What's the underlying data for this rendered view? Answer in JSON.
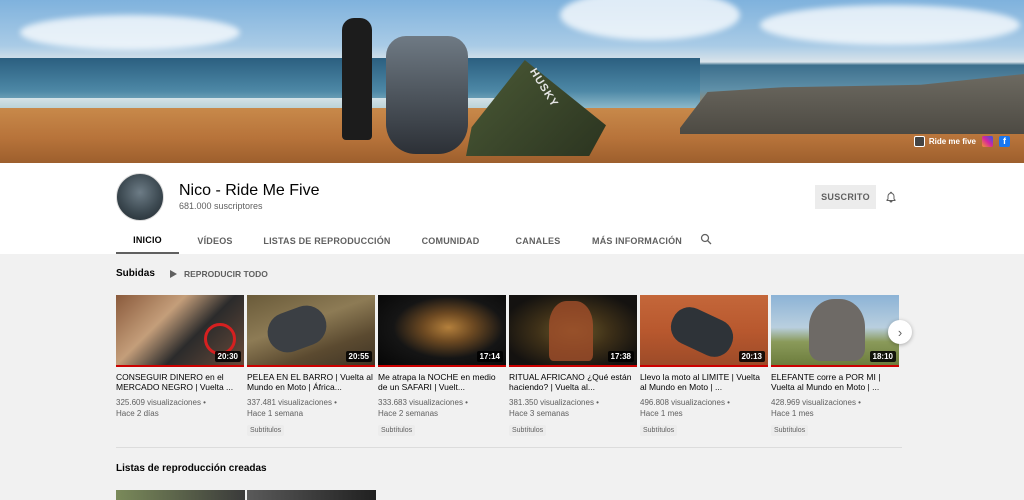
{
  "banner": {
    "tent_label": "HUSKY",
    "links": [
      {
        "label": "Ride me five",
        "icon": "ride-me-five-icon",
        "color": "#444444"
      },
      {
        "label": "",
        "icon": "instagram-icon",
        "color": "#d6249f"
      },
      {
        "label": "",
        "icon": "facebook-icon",
        "color": "#1877f2"
      }
    ]
  },
  "channel": {
    "name": "Nico - Ride Me Five",
    "subscribers": "681.000 suscriptores",
    "subscribe_button": "SUSCRITO"
  },
  "tabs": [
    "INICIO",
    "VÍDEOS",
    "LISTAS DE REPRODUCCIÓN",
    "COMUNIDAD",
    "CANALES",
    "MÁS INFORMACIÓN"
  ],
  "uploads": {
    "title": "Subidas",
    "play_all": "REPRODUCIR TODO"
  },
  "videos": [
    {
      "title": "CONSEGUIR DINERO en el MERCADO NEGRO | Vuelta ...",
      "duration": "20:30",
      "views": "325.609 visualizaciones •",
      "age": "Hace 2 días",
      "badge": ""
    },
    {
      "title": "PELEA EN EL BARRO | Vuelta al Mundo en Moto | África...",
      "duration": "20:55",
      "views": "337.481 visualizaciones •",
      "age": "Hace 1 semana",
      "badge": "Subtítulos"
    },
    {
      "title": "Me atrapa la NOCHE en medio de un SAFARI | Vuelt...",
      "duration": "17:14",
      "views": "333.683 visualizaciones •",
      "age": "Hace 2 semanas",
      "badge": "Subtítulos"
    },
    {
      "title": "RITUAL AFRICANO ¿Qué están haciendo? | Vuelta al...",
      "duration": "17:38",
      "views": "381.350 visualizaciones •",
      "age": "Hace 3 semanas",
      "badge": "Subtítulos"
    },
    {
      "title": "Llevo la moto al LIMITE | Vuelta al Mundo en Moto | ...",
      "duration": "20:13",
      "views": "496.808 visualizaciones •",
      "age": "Hace 1 mes",
      "badge": "Subtítulos"
    },
    {
      "title": "ELEFANTE corre a POR MI | Vuelta al Mundo en Moto | ...",
      "duration": "18:10",
      "views": "428.969 visualizaciones •",
      "age": "Hace 1 mes",
      "badge": "Subtítulos"
    }
  ],
  "playlists": {
    "title": "Listas de reproducción creadas"
  },
  "colors": {
    "progress_bar": "#cc0000",
    "text_primary": "#030303",
    "text_secondary": "#606060"
  }
}
